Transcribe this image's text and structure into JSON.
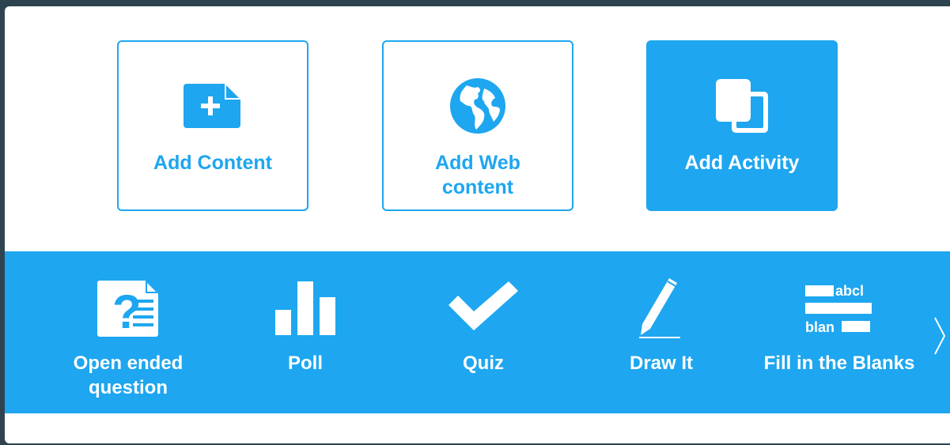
{
  "colors": {
    "accent": "#1ea6f0",
    "background": "#ffffff",
    "backdrop": "#2f4450"
  },
  "cards": [
    {
      "label": "Add Content",
      "icon": "file-plus-icon",
      "active": false
    },
    {
      "label": "Add Web content",
      "icon": "globe-icon",
      "active": false
    },
    {
      "label": "Add Activity",
      "icon": "copy-pages-icon",
      "active": true
    }
  ],
  "activities": [
    {
      "label": "Open ended question",
      "icon": "question-document-icon"
    },
    {
      "label": "Poll",
      "icon": "bar-chart-icon"
    },
    {
      "label": "Quiz",
      "icon": "checkmark-icon"
    },
    {
      "label": "Draw It",
      "icon": "pencil-icon"
    },
    {
      "label": "Fill in the Blanks",
      "icon": "fill-blanks-icon"
    }
  ],
  "fill_blanks_icon": {
    "word_top": "abcl",
    "word_bottom": "blan"
  },
  "navigation": {
    "next_icon": "chevron-right-icon"
  }
}
